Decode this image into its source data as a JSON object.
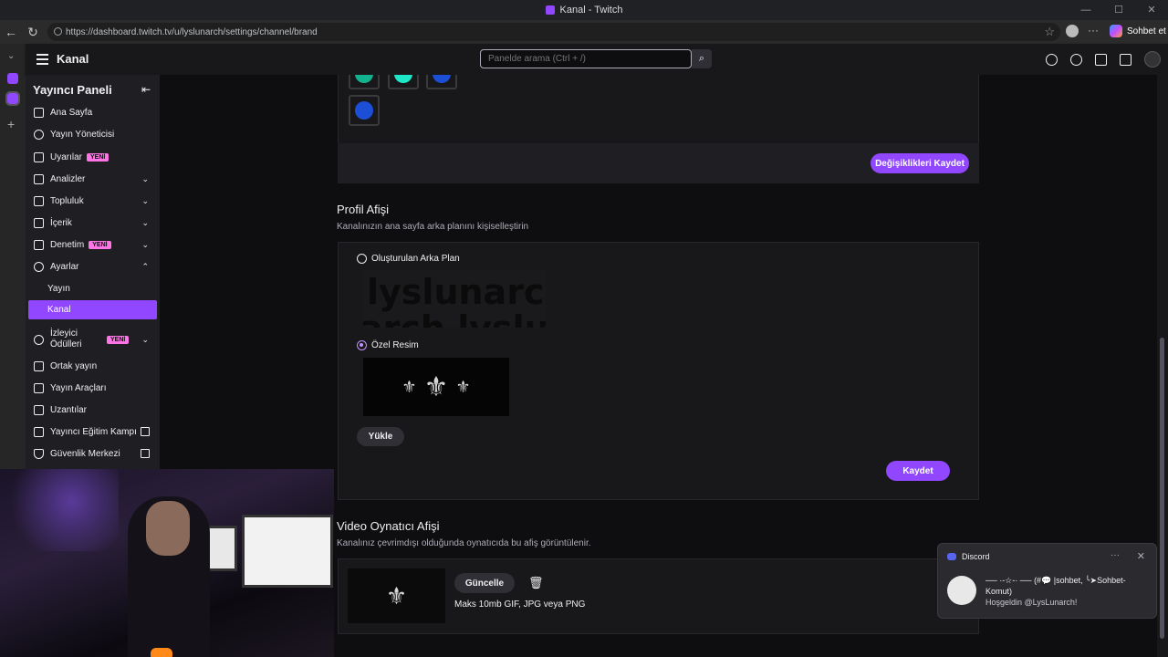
{
  "window": {
    "title": "Kanal - Twitch"
  },
  "browser": {
    "url": "https://dashboard.twitch.tv/u/lyslunarch/settings/channel/brand",
    "copilot_label": "Sohbet et"
  },
  "topnav": {
    "page_title": "Kanal",
    "search_placeholder": "Panelde arama (Ctrl + /)"
  },
  "sidebar": {
    "header": "Yayıncı Paneli",
    "items": [
      {
        "label": "Ana Sayfa"
      },
      {
        "label": "Yayın Yöneticisi"
      },
      {
        "label": "Uyarılar",
        "badge": "YENİ"
      },
      {
        "label": "Analizler"
      },
      {
        "label": "Topluluk"
      },
      {
        "label": "İçerik"
      },
      {
        "label": "Denetim",
        "badge": "YENİ"
      },
      {
        "label": "Ayarlar"
      }
    ],
    "sub_items": [
      {
        "label": "Yayın"
      },
      {
        "label": "Kanal",
        "active": true
      }
    ],
    "items2": [
      {
        "label": "İzleyici Ödülleri",
        "badge": "YENİ"
      },
      {
        "label": "Ortak yayın"
      },
      {
        "label": "Yayın Araçları"
      },
      {
        "label": "Uzantılar"
      },
      {
        "label": "Yayıncı Eğitim Kampı"
      },
      {
        "label": "Güvenlik Merkezi"
      }
    ]
  },
  "color_section": {
    "swatch_colors": [
      "#13b28f",
      "#1ee6c8",
      "#1c4fd6",
      "#1c4fd6"
    ],
    "save_label": "Değişiklikleri Kaydet"
  },
  "profile_banner": {
    "title": "Profil Afişi",
    "description": "Kanalınızın ana sayfa arka planını kişiselleştirin",
    "option_generated": "Oluşturulan Arka Plan",
    "generated_text_1": "lyslunarc",
    "generated_text_2": "arch lyslu",
    "option_custom": "Özel Resim",
    "custom_selected": true,
    "upload_label": "Yükle",
    "save_label": "Kaydet"
  },
  "video_banner": {
    "title": "Video Oynatıcı Afişi",
    "description": "Kanalınız çevrimdışı olduğunda oynatıcıda bu afiş görüntülenir.",
    "update_label": "Güncelle",
    "info": "Maks 10mb GIF, JPG veya PNG"
  },
  "notification": {
    "app": "Discord",
    "message": "── ·-☆-· ── (#💬 |sohbet, ╰➤Sohbet-Komut)",
    "sub": "Hoşgeldin @LysLunarch!"
  },
  "colors": {
    "accent": "#9147ff",
    "badge": "#ff75e6"
  }
}
